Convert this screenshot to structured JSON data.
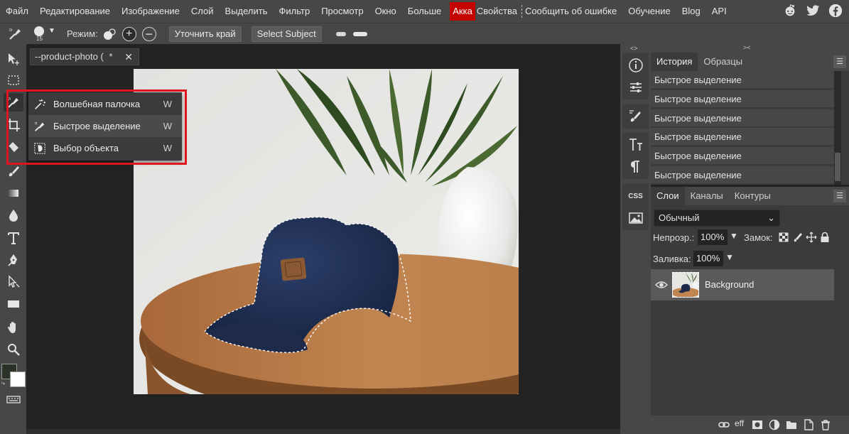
{
  "menubar": {
    "items": [
      "Файл",
      "Редактирование",
      "Изображение",
      "Слой",
      "Выделить",
      "Фильтр",
      "Просмотр",
      "Окно",
      "Больше"
    ],
    "account": "Акка",
    "properties": "Свойства",
    "report": "Сообщить об ошибке",
    "learn": "Обучение",
    "blog": "Blog",
    "api": "API",
    "social_icons": [
      "reddit-icon",
      "twitter-icon",
      "facebook-icon"
    ]
  },
  "options": {
    "brush_size": "15",
    "mode_label": "Режим:",
    "refine_edge": "Уточнить край",
    "select_subject": "Select Subject"
  },
  "document": {
    "tab_title": "--product-photo (",
    "tab_modified": "*",
    "close": "✕"
  },
  "flyout": {
    "items": [
      {
        "label": "Волшебная палочка",
        "key": "W",
        "icon": "magic-wand-icon"
      },
      {
        "label": "Быстрое выделение",
        "key": "W",
        "icon": "quick-selection-icon"
      },
      {
        "label": "Выбор объекта",
        "key": "W",
        "icon": "object-selection-icon"
      }
    ]
  },
  "history": {
    "tabs": [
      "История",
      "Образцы"
    ],
    "rows": [
      "Быстрое выделение",
      "Быстрое выделение",
      "Быстрое выделение",
      "Быстрое выделение",
      "Быстрое выделение",
      "Быстрое выделение"
    ]
  },
  "layers": {
    "tabs": [
      "Слои",
      "Каналы",
      "Контуры"
    ],
    "blend_mode": "Обычный",
    "opacity_label": "Непрозр.:",
    "opacity_value": "100%",
    "lock_label": "Замок:",
    "fill_label": "Заливка:",
    "fill_value": "100%",
    "layer_name": "Background",
    "footer_fx": "eff"
  },
  "iconcol": {
    "grip_left": "<>",
    "grip_right": "><",
    "css": "CSS"
  },
  "colors": {
    "menubar": "#474747",
    "workspace": "#232323",
    "panel": "#3b3b3b",
    "highlight_box": "#e0141d",
    "account_badge": "#c40000"
  }
}
